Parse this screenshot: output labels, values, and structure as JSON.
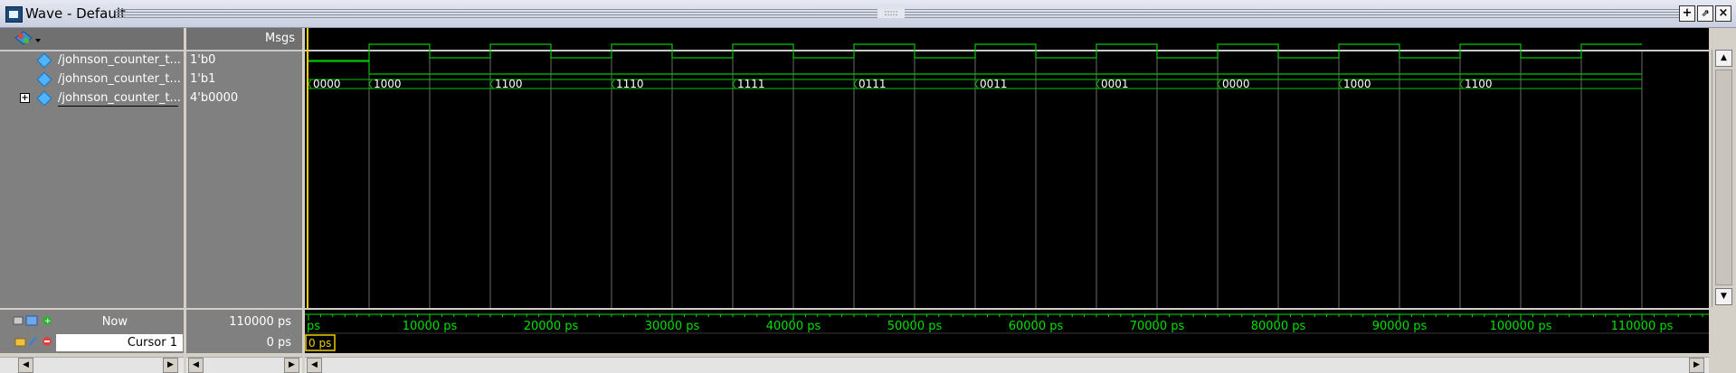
{
  "window": {
    "title": "Wave - Default",
    "grip_label": ":::::",
    "buttons": [
      "+",
      "⇗",
      "×"
    ]
  },
  "header": {
    "msgs_label": "Msgs"
  },
  "signals": [
    {
      "name": "/johnson_counter_t...",
      "value": "1'b0",
      "kind": "wire",
      "expandable": false
    },
    {
      "name": "/johnson_counter_t...",
      "value": "1'b1",
      "kind": "wire",
      "expandable": false
    },
    {
      "name": "/johnson_counter_t...",
      "value": "4'b0000",
      "kind": "bus",
      "expandable": true
    }
  ],
  "bus_values": [
    "0000",
    "1000",
    "1100",
    "1110",
    "1111",
    "0111",
    "0011",
    "0001",
    "0000",
    "1000",
    "1100"
  ],
  "clock_period_ps": 10000,
  "sim_end_ps": 110000,
  "reset_high_until_ps": 5000,
  "timeline": {
    "tick_labels": [
      "ps",
      "10000 ps",
      "20000 ps",
      "30000 ps",
      "40000 ps",
      "50000 ps",
      "60000 ps",
      "70000 ps",
      "80000 ps",
      "90000 ps",
      "100000 ps",
      "110000 ps"
    ],
    "start_ps": 0
  },
  "status": {
    "now_label": "Now",
    "now_value": "110000 ps",
    "cursor_label": "Cursor 1",
    "cursor_value": "0 ps",
    "cursor_marker": "0 ps"
  },
  "colors": {
    "wave": "#00c800",
    "cursor": "#f0d000",
    "grid": "#6a6a6a",
    "tick_text": "#00e000"
  }
}
